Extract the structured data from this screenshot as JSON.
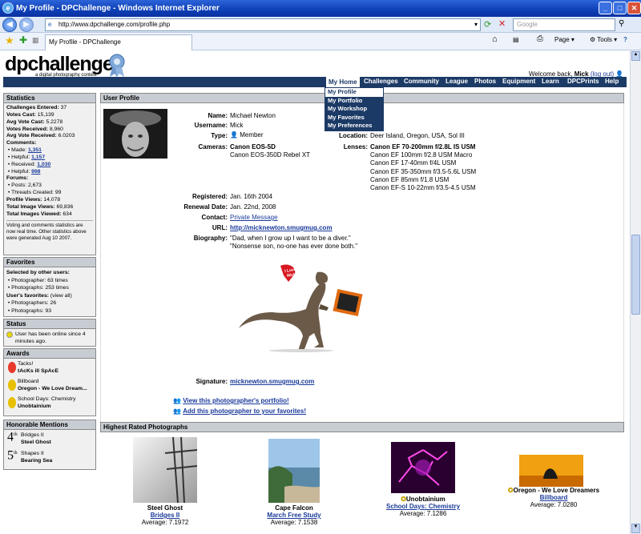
{
  "window": {
    "title": "My Profile - DPChallenge - Windows Internet Explorer",
    "url": "http://www.dpchallenge.com/profile.php",
    "search_placeholder": "Google",
    "tab_title": "My Profile - DPChallenge"
  },
  "browser_tools": {
    "page": "Page",
    "tools": "Tools"
  },
  "site": {
    "logo": "dpchallenge",
    "tagline": "a digital photography contest",
    "welcome_prefix": "Welcome back,",
    "user": "Mick",
    "logout": "(log out)"
  },
  "nav": [
    "My Home",
    "Challenges",
    "Community",
    "League",
    "Photos",
    "Equipment",
    "Learn",
    "DPCPrints",
    "Help"
  ],
  "dropdown": [
    "My Profile",
    "My Portfolio",
    "My Workshop",
    "My Favorites",
    "My Preferences"
  ],
  "stats": {
    "title": "Statistics",
    "challenges_entered_label": "Challenges Entered:",
    "challenges_entered": "37",
    "votes_cast_label": "Votes Cast:",
    "votes_cast": "15,139",
    "avg_vote_cast_label": "Avg Vote Cast:",
    "avg_vote_cast": "5.2278",
    "votes_received_label": "Votes Received:",
    "votes_received": "8,960",
    "avg_vote_received_label": "Avg Vote Received:",
    "avg_vote_received": "6.0203",
    "comments_label": "Comments:",
    "made_label": "Made:",
    "made": "1,351",
    "helpful1_label": "Helpful:",
    "helpful1": "1,157",
    "received_label": "Received:",
    "received": "1,030",
    "helpful2_label": "Helpful:",
    "helpful2": "998",
    "forums_label": "Forums:",
    "posts_label": "Posts:",
    "posts": "2,673",
    "threads_label": "Threads Created:",
    "threads": "99",
    "profile_views_label": "Profile Views:",
    "profile_views": "14,078",
    "image_views_label": "Total Image Views:",
    "image_views": "69,836",
    "images_viewed_label": "Total Images Viewed:",
    "images_viewed": "634",
    "note": "Voting and comments statistics are now real time. Other statistics above were generated Aug 10 2007."
  },
  "favorites": {
    "title": "Favorites",
    "selected_label": "Selected by other users:",
    "photographer": "Photographer: 63 times",
    "photographs": "Photographs: 253 times",
    "users_label": "User's favorites:",
    "view_all": "(view all)",
    "u_photographers": "Photographers: 26",
    "u_photographs": "Photographs: 93"
  },
  "status": {
    "title": "Status",
    "text": "User has been online since 4 minutes ago."
  },
  "awards": {
    "title": "Awards",
    "items": [
      {
        "type": "Tacks!",
        "name": "tAcKs ill SpAcE"
      },
      {
        "type": "Billboard",
        "name": "Oregon - We Love Dream..."
      },
      {
        "type": "School Days: Chemistry",
        "name": "Unobtainium"
      }
    ]
  },
  "honorable": {
    "title": "Honorable Mentions",
    "items": [
      {
        "place": "4",
        "sup": "th",
        "challenge": "Bridges II",
        "name": "Steel Ghost"
      },
      {
        "place": "5",
        "sup": "th",
        "challenge": "Shapes II",
        "name": "Bearing Sea"
      }
    ]
  },
  "profile": {
    "section_title": "User Profile",
    "name_label": "Name:",
    "name": "Michael Newton",
    "username_label": "Username:",
    "username": "Mick",
    "type_label": "Type:",
    "type": "Member",
    "cameras_label": "Cameras:",
    "camera1": "Canon EOS-5D",
    "camera2": "Canon EOS-350D Rebel XT",
    "location_label": "Location:",
    "location": "Deer Island, Oregon, USA, Sol III",
    "lenses_label": "Lenses:",
    "lenses": [
      "Canon EF 70-200mm f/2.8L IS USM",
      "Canon EF 100mm f/2.8 USM Macro",
      "Canon EF 17-40mm f/4L USM",
      "Canon EF 35-350mm f/3.5-5.6L USM",
      "Canon EF 85mm f/1.8 USM",
      "Canon EF-S 10-22mm f/3.5-4.5 USM"
    ],
    "registered_label": "Registered:",
    "registered": "Jan. 16th 2004",
    "renewal_label": "Renewal Date:",
    "renewal": "Jan. 22nd, 2008",
    "contact_label": "Contact:",
    "contact": "Private Message",
    "url_label": "URL:",
    "url": "http://micknewton.smugmug.com",
    "bio_label": "Biography:",
    "bio1": "\"Dad, when I grow up I want to be a diver.\"",
    "bio2": "\"Nonsense son, no-one has ever done both.\"",
    "heart_text": "I Love Mick",
    "signature_label": "Signature:",
    "signature": "micknewton.smugmug.com",
    "view_portfolio": "View this photographer's portfolio!",
    "add_favorites": "Add this photographer to your favorites!"
  },
  "highest": {
    "title": "Highest Rated Photographs",
    "items": [
      {
        "title": "Steel Ghost",
        "challenge": "Bridges II",
        "avg": "Average: 7.1972"
      },
      {
        "title": "Cape Falcon",
        "challenge": "March Free Study",
        "avg": "Average: 7.1538"
      },
      {
        "title": "Unobtainium",
        "challenge": "School Days: Chemistry",
        "avg": "Average: 7.1286"
      },
      {
        "title": "Oregon - We Love Dreamers",
        "challenge": "Billboard",
        "avg": "Average: 7.0280"
      }
    ]
  }
}
